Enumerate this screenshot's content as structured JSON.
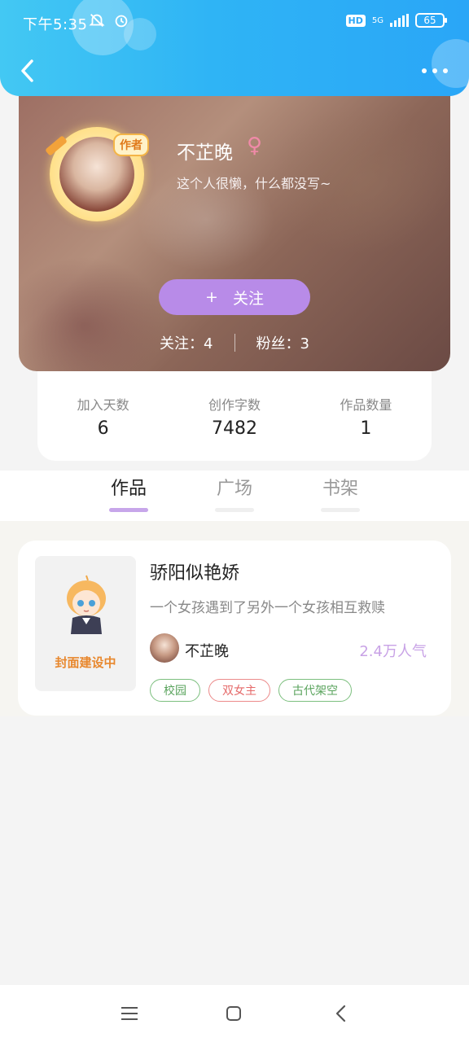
{
  "status_bar": {
    "time": "下午5:35",
    "network": "5G",
    "hd_badge": "HD",
    "battery": "65"
  },
  "header": {
    "back_icon": "chevron-left-icon",
    "more_icon": "more-dots-icon"
  },
  "profile": {
    "username": "不芷晚",
    "gender_symbol": "♀",
    "bio": "这个人很懒，什么都没写~",
    "avatar_tag": "作者",
    "follow_button": {
      "icon": "+",
      "label": "关注"
    },
    "following": "关注：4",
    "followers": "粉丝：3"
  },
  "stats": [
    {
      "label": "加入天数",
      "value": "6"
    },
    {
      "label": "创作字数",
      "value": "7482"
    },
    {
      "label": "作品数量",
      "value": "1"
    }
  ],
  "tabs": [
    {
      "label": "作品",
      "active": true
    },
    {
      "label": "广场",
      "active": false
    },
    {
      "label": "书架",
      "active": false
    }
  ],
  "works": [
    {
      "title": "骄阳似艳娇",
      "description": "一个女孩遇到了另外一个女孩相互救赎",
      "cover_text": "封面建设中",
      "author": "不芷晚",
      "popularity": "2.4万人气",
      "tags": [
        {
          "label": "校园",
          "color": "#59a35c"
        },
        {
          "label": "双女主",
          "color": "#e56a6a"
        },
        {
          "label": "古代架空",
          "color": "#59a35c"
        }
      ]
    }
  ],
  "colors": {
    "header_gradient_start": "#43c8f3",
    "header_gradient_end": "#2aa6f7",
    "accent_purple": "#b88be8",
    "popularity_color": "#c8a2e6"
  },
  "nav_icons": [
    "menu-icon",
    "home-square-icon",
    "back-triangle-icon"
  ]
}
